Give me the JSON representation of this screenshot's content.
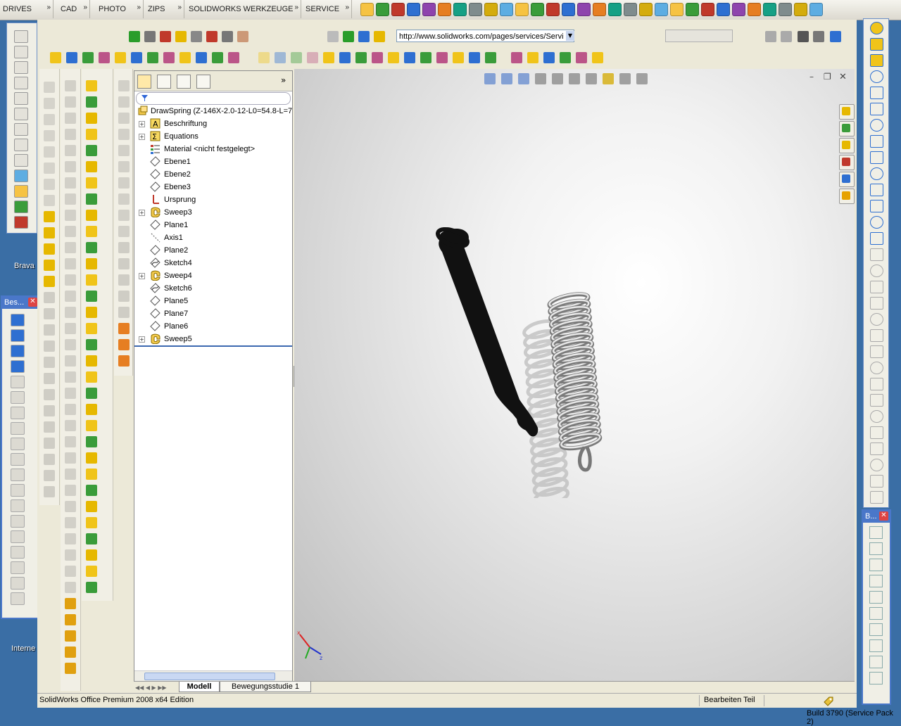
{
  "taskbar": {
    "tabs": [
      "DRIVES",
      "CAD",
      "PHOTO",
      "ZIPS",
      "SOLIDWORKS WERKZEUGE",
      "SERVICE"
    ],
    "chevron": "»"
  },
  "desktop": {
    "label_brava": "Brava",
    "label_internet": "Interne",
    "status_build": "Build 3790 (Service Pack 2)"
  },
  "floating_panels": {
    "besch_title": "Bes...",
    "right_panel_title": "B...",
    "close_glyph": "✕"
  },
  "toolbar": {
    "url": "http://www.solidworks.com/pages/services/Servi",
    "url_dropdown_glyph": "▼"
  },
  "feature_tree": {
    "root": "DrawSpring  (Z-146X-2.0-12-L0=54.8-L=7",
    "items": [
      {
        "label": "Beschriftung",
        "icon": "annotations-icon",
        "expandable": true
      },
      {
        "label": "Equations",
        "icon": "equations-icon",
        "expandable": true
      },
      {
        "label": "Material <nicht festgelegt>",
        "icon": "material-icon",
        "expandable": false
      },
      {
        "label": "Ebene1",
        "icon": "plane-icon",
        "expandable": false
      },
      {
        "label": "Ebene2",
        "icon": "plane-icon",
        "expandable": false
      },
      {
        "label": "Ebene3",
        "icon": "plane-icon",
        "expandable": false
      },
      {
        "label": "Ursprung",
        "icon": "origin-icon",
        "expandable": false
      },
      {
        "label": "Sweep3",
        "icon": "sweep-icon",
        "expandable": true
      },
      {
        "label": "Plane1",
        "icon": "plane-icon",
        "expandable": false
      },
      {
        "label": "Axis1",
        "icon": "axis-icon",
        "expandable": false
      },
      {
        "label": "Plane2",
        "icon": "plane-icon",
        "expandable": false
      },
      {
        "label": "Sketch4",
        "icon": "sketch-icon",
        "expandable": false
      },
      {
        "label": "Sweep4",
        "icon": "sweep-icon",
        "expandable": true
      },
      {
        "label": "Sketch6",
        "icon": "sketch-icon",
        "expandable": false
      },
      {
        "label": "Plane5",
        "icon": "plane-icon",
        "expandable": false
      },
      {
        "label": "Plane7",
        "icon": "plane-icon",
        "expandable": false
      },
      {
        "label": "Plane6",
        "icon": "plane-icon",
        "expandable": false
      },
      {
        "label": "Sweep5",
        "icon": "sweep-icon",
        "expandable": true
      }
    ],
    "expand_glyph": "+",
    "collapse_panel_glyph": "»"
  },
  "bottom_tabs": {
    "model": "Modell",
    "motion_study": "Bewegungsstudie 1"
  },
  "status_bar": {
    "product": "SolidWorks Office Premium 2008 x64 Edition",
    "mode": "Bearbeiten Teil"
  },
  "window_controls": {
    "minimize": "–",
    "restore": "❐",
    "close": "✕"
  },
  "colors": {
    "desktop_blue": "#3a6ea5",
    "panel_title_blue": "#4a77c9",
    "spring_dark": "#111111",
    "spring_light": "#c8c8c8"
  }
}
